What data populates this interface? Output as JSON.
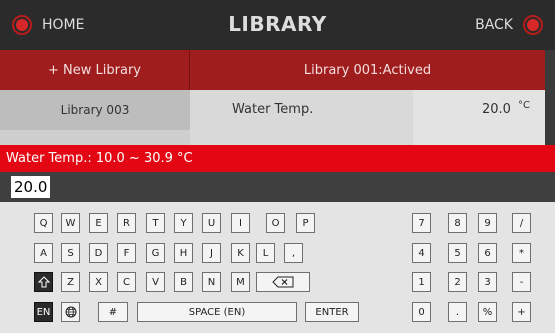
{
  "header": {
    "home_label": "HOME",
    "title": "LIBRARY",
    "back_label": "BACK"
  },
  "library_bar": {
    "new_library": "+ New Library",
    "active_library": "Library 001:Actived"
  },
  "list": {
    "item_label": "Library 003"
  },
  "parameter": {
    "name": "Water Temp.",
    "value": "20.0",
    "unit": "°C"
  },
  "range_text": "Water Temp.: 10.0 ~ 30.9 °C",
  "input_value": "20.0",
  "keyboard": {
    "row1": [
      "Q",
      "W",
      "E",
      "R",
      "T",
      "Y",
      "U",
      "I",
      "O",
      "P"
    ],
    "row2": [
      "A",
      "S",
      "D",
      "F",
      "G",
      "H",
      "J",
      "K",
      "L",
      ","
    ],
    "row3": [
      "Z",
      "X",
      "C",
      "V",
      "B",
      "N",
      "M"
    ],
    "lang_label": "EN",
    "hash_label": "#",
    "space_label": "SPACE (EN)",
    "enter_label": "ENTER",
    "num_row1": [
      "7",
      "8",
      "9",
      "/"
    ],
    "num_row2": [
      "4",
      "5",
      "6",
      "*"
    ],
    "num_row3": [
      "1",
      "2",
      "3",
      "-"
    ],
    "num_row4": [
      "0",
      ".",
      "%",
      "+"
    ]
  }
}
